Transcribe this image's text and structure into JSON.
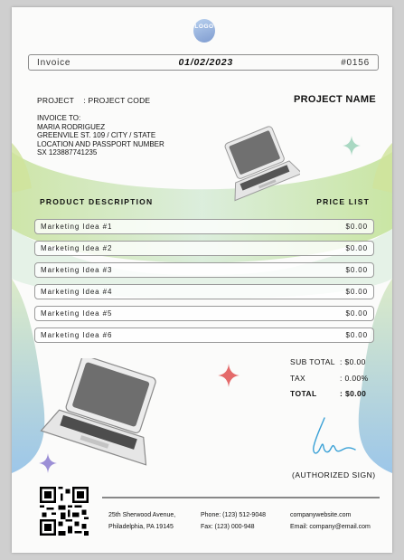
{
  "logo_text": "LOGO",
  "invoice": {
    "label": "Invoice",
    "date": "01/02/2023",
    "number": "#0156"
  },
  "project": {
    "label": "PROJECT",
    "code": ": PROJECT CODE",
    "name": "PROJECT NAME"
  },
  "invoice_to": {
    "label": "INVOICE TO:",
    "lines": [
      "MARIA RODRIGUEZ",
      "GREENVILE ST. 109 / CITY / STATE",
      "LOCATION AND PASSPORT NUMBER",
      "SX 123887741235"
    ]
  },
  "table": {
    "col_description": "PRODUCT DESCRIPTION",
    "col_price": "PRICE LIST",
    "rows": [
      {
        "description": "Marketing Idea #1",
        "price": "$0.00"
      },
      {
        "description": "Marketing Idea #2",
        "price": "$0.00"
      },
      {
        "description": "Marketing Idea #3",
        "price": "$0.00"
      },
      {
        "description": "Marketing Idea #4",
        "price": "$0.00"
      },
      {
        "description": "Marketing Idea #5",
        "price": "$0.00"
      },
      {
        "description": "Marketing Idea #6",
        "price": "$0.00"
      }
    ]
  },
  "totals": {
    "subtotal_label": "SUB TOTAL",
    "subtotal_value": ": $0.00",
    "tax_label": "TAX",
    "tax_value": ": 0.00%",
    "total_label": "TOTAL",
    "total_value": ": $0.00"
  },
  "signature_label": "(AUTHORIZED SIGN)",
  "footer": {
    "address_line1": "25th Sherwood Avenue,",
    "address_line2": "Philadelphia, PA 19145",
    "phone": "Phone: (123) 512-9048",
    "fax": "Fax: (123) 000-948",
    "website": "companywebsite.com",
    "email": "Email: company@email.com"
  },
  "colors": {
    "accent_blue": "#9ec4e6",
    "accent_green": "#cfe39b",
    "sparkle_red": "#e46a6a",
    "sparkle_green": "#a9d8c2",
    "signature": "#3aa1d6"
  }
}
